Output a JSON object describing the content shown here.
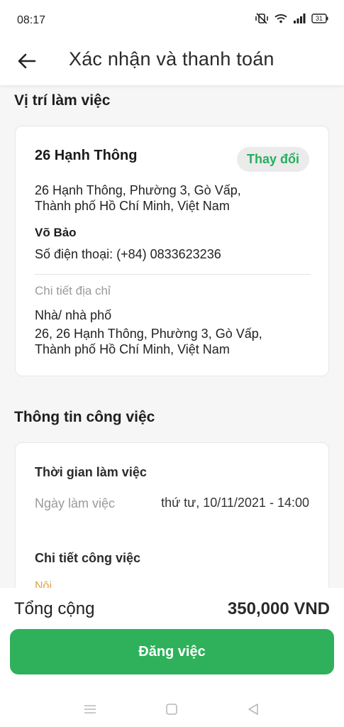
{
  "status": {
    "time": "08:17",
    "battery": "31",
    "icons": [
      "mute-vibrate-icon",
      "wifi-icon",
      "signal-icon",
      "battery-icon"
    ]
  },
  "header": {
    "title": "Xác nhận và thanh toán",
    "back_icon": "arrow-left-icon"
  },
  "location": {
    "section_title": "Vị trí làm việc",
    "address_name": "26 Hạnh Thông",
    "change_label": "Thay đổi",
    "address_line1": "26 Hạnh Thông, Phường 3, Gò Vấp,",
    "address_line2": "Thành phố Hồ Chí Minh, Việt Nam",
    "contact_name": "Võ Bảo",
    "phone": "Số điện thoại: (+84) 0833623236",
    "detail_label": "Chi tiết địa chỉ",
    "house_type": "Nhà/ nhà phố",
    "detail_line1": "26, 26 Hạnh Thông, Phường 3, Gò Vấp,",
    "detail_line2": "Thành phố Hồ Chí Minh, Việt Nam"
  },
  "job": {
    "section_title": "Thông tin công việc",
    "time_title": "Thời gian làm việc",
    "date_label": "Ngày làm việc",
    "date_value": "thứ tư, 10/11/2021 - 14:00",
    "detail_title": "Chi tiết công việc",
    "partial_text": "Nội"
  },
  "footer": {
    "total_label": "Tổng cộng",
    "total_value": "350,000 VND",
    "submit_label": "Đăng việc"
  },
  "colors": {
    "accent": "#2eb15a",
    "accent_text": "#27ae60"
  }
}
